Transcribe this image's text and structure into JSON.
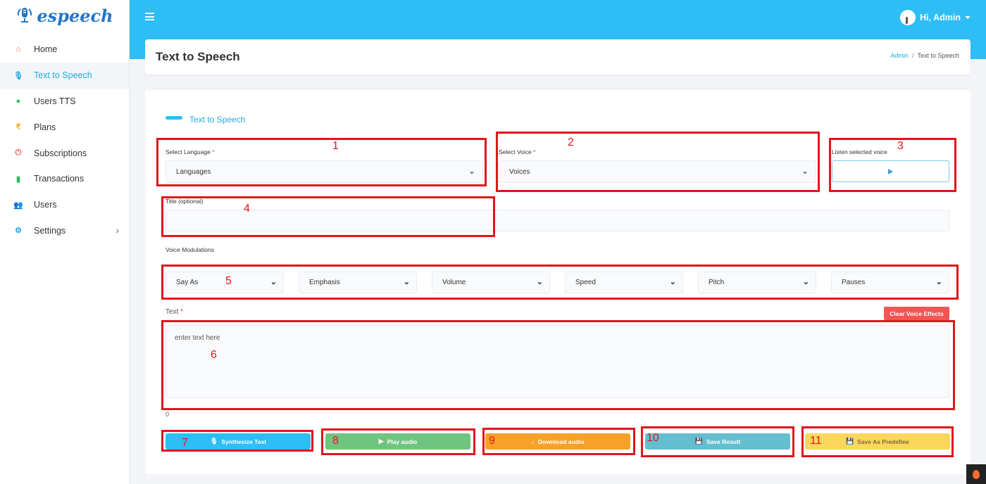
{
  "brand": {
    "name": "espeech",
    "color": "#2576c6"
  },
  "sidebar": {
    "items": [
      {
        "label": "Home",
        "icon": "home-icon",
        "glyph": "⌂",
        "color": "#f25554"
      },
      {
        "label": "Text to Speech",
        "icon": "microphone-icon",
        "glyph": "🎙",
        "color": "#23a9e0",
        "active": true
      },
      {
        "label": "Users TTS",
        "icon": "chat-icon",
        "glyph": "●",
        "color": "#2ebd59"
      },
      {
        "label": "Plans",
        "icon": "rupee-icon",
        "glyph": "₹",
        "color": "#f5a623"
      },
      {
        "label": "Subscriptions",
        "icon": "power-icon",
        "glyph": "⏻",
        "color": "#f25554"
      },
      {
        "label": "Transactions",
        "icon": "file-icon",
        "glyph": "▮",
        "color": "#2ebd59"
      },
      {
        "label": "Users",
        "icon": "users-icon",
        "glyph": "👥",
        "color": "#3d9be0"
      },
      {
        "label": "Settings",
        "icon": "gear-icon",
        "glyph": "⚙",
        "color": "#23a9e0",
        "has_submenu": true
      }
    ]
  },
  "topbar": {
    "user_greeting": "Hi, Admin",
    "accent": "#2ebdf4"
  },
  "header": {
    "title": "Text to Speech",
    "breadcrumb": {
      "root": "Admin",
      "separator": "/",
      "current": "Text to Speech"
    }
  },
  "form": {
    "section_title": "Text to Speech",
    "language": {
      "label": "Select Language",
      "required": "*",
      "value": "Languages"
    },
    "voice": {
      "label": "Select Voice",
      "required": "*",
      "value": "Voices"
    },
    "listen": {
      "label": "Listen selected voice"
    },
    "title_field": {
      "label": "Title (optional)",
      "value": ""
    },
    "modulations": {
      "label": "Voice Modulations",
      "options": [
        "Say As",
        "Emphasis",
        "Volume",
        "Speed",
        "Pitch",
        "Pauses"
      ]
    },
    "text": {
      "label": "Text",
      "required": "*",
      "placeholder": "enter text here",
      "counter": "0"
    },
    "clear_effects": "Clear Voice Effects",
    "actions": [
      {
        "label": "Synthesize Text",
        "icon": "microphone-icon",
        "glyph": "🎙",
        "color": "#2ebdf4"
      },
      {
        "label": "Play audio",
        "icon": "play-icon",
        "glyph": "▶",
        "color": "#6fc57f"
      },
      {
        "label": "Download audio",
        "icon": "download-icon",
        "glyph": "↓",
        "color": "#f7a128"
      },
      {
        "label": "Save Result",
        "icon": "save-icon",
        "glyph": "💾",
        "color": "#63bfd0"
      },
      {
        "label": "Save As Predefine",
        "icon": "save-icon",
        "glyph": "💾",
        "color": "#fdd75b"
      }
    ]
  },
  "annotations": [
    "1",
    "2",
    "3",
    "4",
    "5",
    "6",
    "7",
    "8",
    "9",
    "10",
    "11"
  ]
}
